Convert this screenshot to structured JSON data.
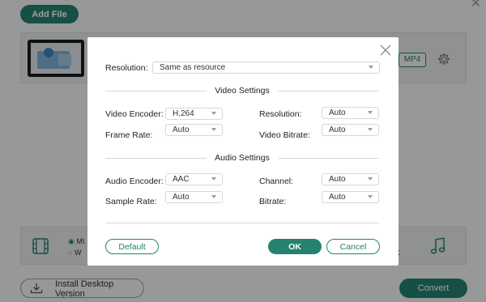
{
  "app": {
    "add_file_label": "Add File",
    "format_label": "MP4",
    "bottom_radio_1": "MI",
    "bottom_radio_2": "W",
    "bottom_text": "k",
    "install_label": "Install Desktop Version",
    "convert_label": "Convert"
  },
  "dialog": {
    "resolution_label": "Resolution:",
    "resolution_value": "Same as resource",
    "video_section_title": "Video Settings",
    "video": {
      "encoder_label": "Video Encoder:",
      "encoder_value": "H.264",
      "resolution_label": "Resolution:",
      "resolution_value": "Auto",
      "frame_rate_label": "Frame Rate:",
      "frame_rate_value": "Auto",
      "bitrate_label": "Video Bitrate:",
      "bitrate_value": "Auto"
    },
    "audio_section_title": "Audio Settings",
    "audio": {
      "encoder_label": "Audio Encoder:",
      "encoder_value": "AAC",
      "channel_label": "Channel:",
      "channel_value": "Auto",
      "sample_rate_label": "Sample Rate:",
      "sample_rate_value": "Auto",
      "bitrate_label": "Bitrate:",
      "bitrate_value": "Auto"
    },
    "default_label": "Default",
    "ok_label": "OK",
    "cancel_label": "Cancel"
  },
  "colors": {
    "accent": "#24826f",
    "overlay": "rgba(0,0,0,0.38)",
    "dialog_bg": "#ffffff"
  }
}
